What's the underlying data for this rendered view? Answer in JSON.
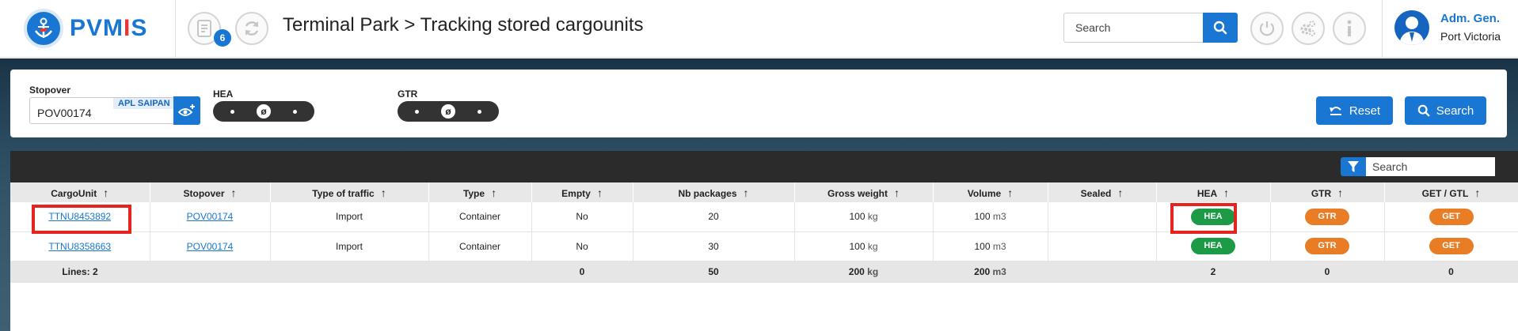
{
  "header": {
    "logo": "PVMIS",
    "notification_count": "6",
    "title": "Terminal Park > Tracking stored cargounits",
    "search_placeholder": "Search",
    "user_name": "Adm. Gen.",
    "user_port": "Port Victoria"
  },
  "filters": {
    "stopover_label": "Stopover",
    "stopover_value": "POV00174",
    "vessel": "APL SAIPAN",
    "hea_label": "HEA",
    "hea_selected": "ø",
    "gtr_label": "GTR",
    "gtr_selected": "ø",
    "reset_label": "Reset",
    "search_label": "Search"
  },
  "grid": {
    "search_placeholder": "Search",
    "columns": [
      "CargoUnit",
      "Stopover",
      "Type of traffic",
      "Type",
      "Empty",
      "Nb packages",
      "Gross weight",
      "Volume",
      "Sealed",
      "HEA",
      "GTR",
      "GET / GTL"
    ],
    "sortable": [
      true,
      true,
      true,
      true,
      true,
      true,
      true,
      true,
      true,
      true,
      true,
      true
    ],
    "rows": [
      {
        "cargounit": "TTNU8453892",
        "stopover": "POV00174",
        "traffic": "Import",
        "type": "Container",
        "empty": "No",
        "packages": "20",
        "weight": "100",
        "weight_unit": "kg",
        "volume": "100",
        "volume_unit": "m3",
        "sealed": "",
        "hea": "HEA",
        "gtr": "GTR",
        "get": "GET"
      },
      {
        "cargounit": "TTNU8358663",
        "stopover": "POV00174",
        "traffic": "Import",
        "type": "Container",
        "empty": "No",
        "packages": "30",
        "weight": "100",
        "weight_unit": "kg",
        "volume": "100",
        "volume_unit": "m3",
        "sealed": "",
        "hea": "HEA",
        "gtr": "GTR",
        "get": "GET"
      }
    ],
    "totals": {
      "lines": "Lines: 2",
      "empty": "0",
      "packages": "50",
      "weight": "200",
      "weight_unit": "kg",
      "volume": "200",
      "volume_unit": "m3",
      "hea": "2",
      "gtr": "0",
      "get": "0"
    }
  },
  "colors": {
    "primary": "#1976d2",
    "hea_badge": "#1c9a46",
    "gtr_badge": "#e87d25",
    "highlight": "#e52420"
  }
}
